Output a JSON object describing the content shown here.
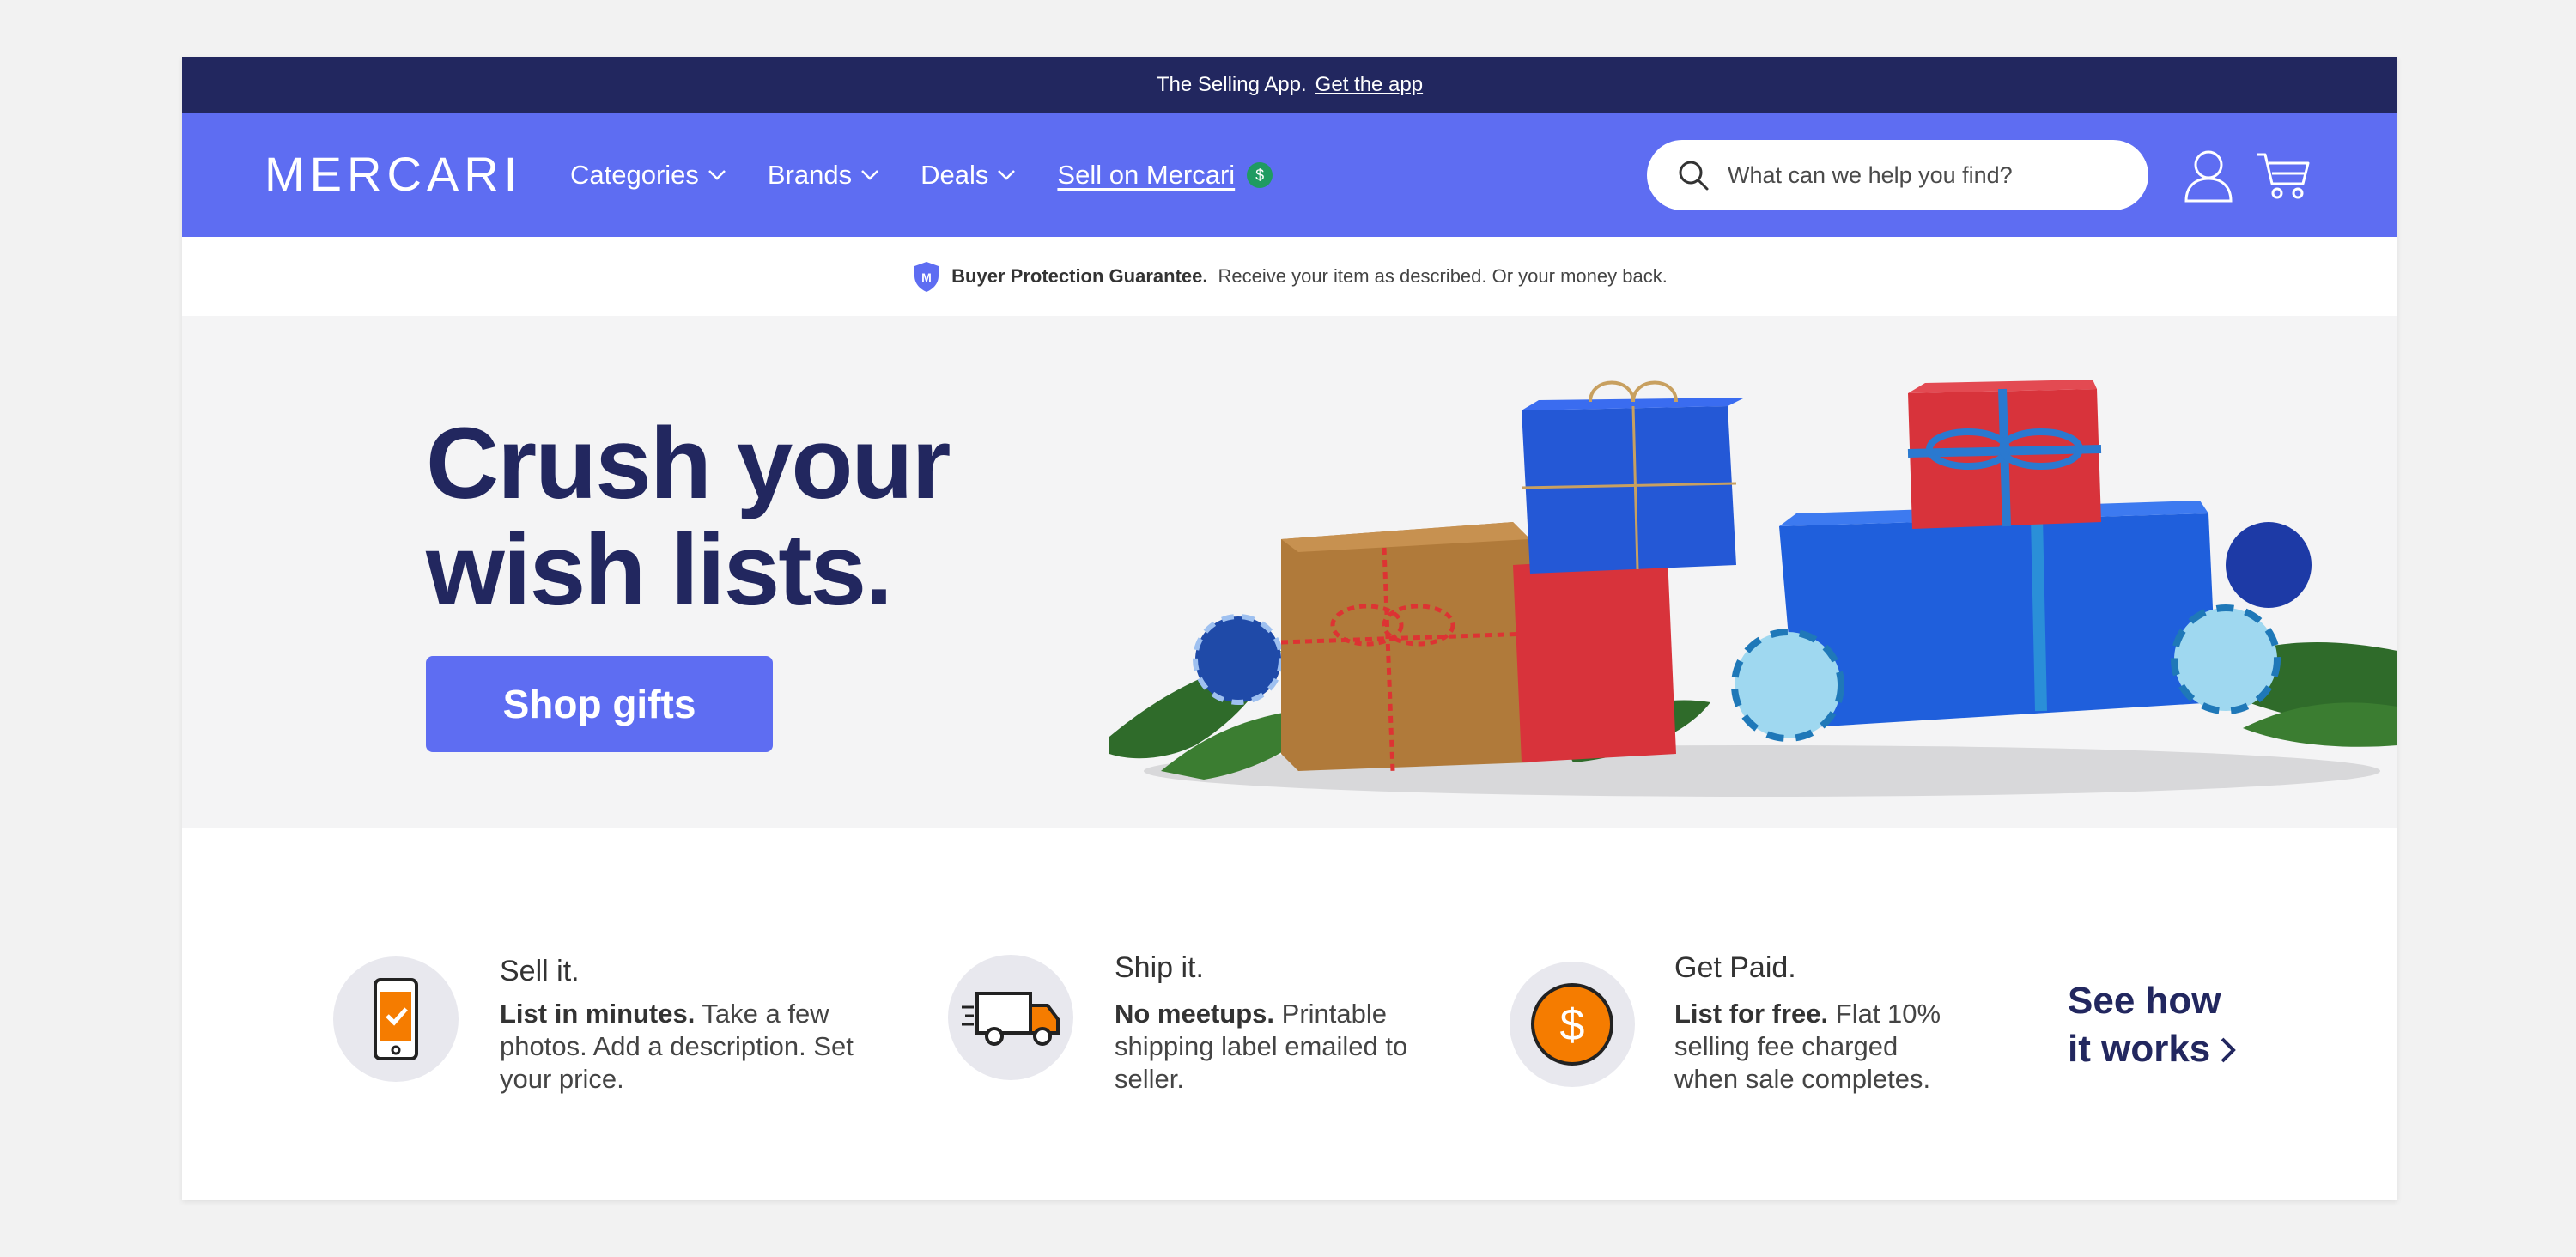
{
  "promo": {
    "text": "The Selling App.",
    "link": "Get the app"
  },
  "header": {
    "logo_text": "MERCARI",
    "nav": [
      {
        "label": "Categories"
      },
      {
        "label": "Brands"
      },
      {
        "label": "Deals"
      }
    ],
    "sell_label": "Sell on Mercari",
    "sell_badge": "$",
    "search_placeholder": "What can we help you find?"
  },
  "guarantee": {
    "title": "Buyer Protection Guarantee.",
    "text": "Receive your item as described. Or your money back."
  },
  "hero": {
    "title_line1": "Crush your",
    "title_line2": "wish lists.",
    "button": "Shop gifts"
  },
  "steps": [
    {
      "title": "Sell it.",
      "bold": "List in minutes.",
      "text": " Take a few photos. Add a description. Set your price.",
      "icon": "phone-check-icon"
    },
    {
      "title": "Ship it.",
      "bold": "No meetups.",
      "text": " Printable shipping label emailed to seller.",
      "icon": "truck-icon"
    },
    {
      "title": "Get Paid.",
      "bold": "List for free.",
      "text": " Flat 10% selling fee charged when sale completes.",
      "icon": "dollar-coin-icon"
    }
  ],
  "see_how": {
    "line1": "See how",
    "line2": "it works"
  },
  "colors": {
    "navy": "#22275f",
    "brand": "#5e6df2",
    "orange": "#f57c00",
    "green": "#1f9b62"
  }
}
